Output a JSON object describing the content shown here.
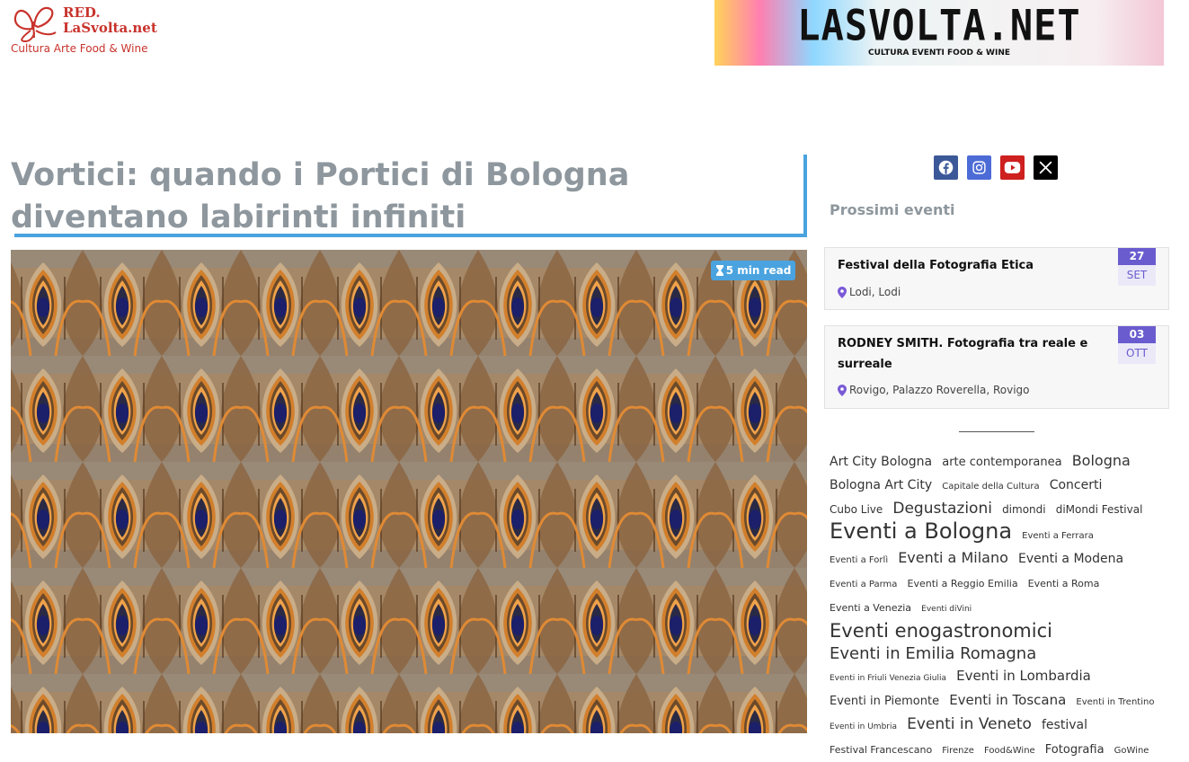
{
  "header": {
    "logo": {
      "name_line1": "RED.",
      "name_line2": "LaSvolta.net",
      "tagline": "Cultura Arte Food & Wine"
    },
    "banner": {
      "title": "LASVOLTA.NET",
      "subtitle": "CULTURA EVENTI FOOD & WINE"
    }
  },
  "article": {
    "title": "Vortici: quando i Portici di Bologna diventano labirinti infiniti",
    "read_time": "5 min read"
  },
  "social": [
    {
      "name": "facebook",
      "icon": "facebook-icon",
      "color": "#3b5998"
    },
    {
      "name": "instagram",
      "icon": "instagram-icon",
      "color": "#4c6bd6"
    },
    {
      "name": "youtube",
      "icon": "youtube-icon",
      "color": "#cd201f"
    },
    {
      "name": "x",
      "icon": "x-icon",
      "color": "#000000"
    }
  ],
  "sidebar": {
    "heading": "Prossimi eventi",
    "events": [
      {
        "title": "Festival della Fotografia Etica",
        "location": "Lodi, Lodi",
        "day": "27",
        "month": "SET"
      },
      {
        "title": "RODNEY SMITH. Fotografia tra reale e surreale",
        "location": "Rovigo, Palazzo Roverella, Rovigo",
        "day": "03",
        "month": "OTT"
      }
    ],
    "tags": [
      {
        "label": "Art City Bologna",
        "size": 14
      },
      {
        "label": "arte contemporanea",
        "size": 13
      },
      {
        "label": "Bologna",
        "size": 16
      },
      {
        "label": "Bologna Art City",
        "size": 14
      },
      {
        "label": "Capitale della Cultura",
        "size": 10
      },
      {
        "label": "Concerti",
        "size": 14
      },
      {
        "label": "Cubo Live",
        "size": 12
      },
      {
        "label": "Degustazioni",
        "size": 17
      },
      {
        "label": "dimondi",
        "size": 12
      },
      {
        "label": "diMondi Festival",
        "size": 12
      },
      {
        "label": "Eventi a Bologna",
        "size": 24
      },
      {
        "label": "Eventi a Ferrara",
        "size": 10
      },
      {
        "label": "Eventi a Forlì",
        "size": 10
      },
      {
        "label": "Eventi a Milano",
        "size": 16
      },
      {
        "label": "Eventi a Modena",
        "size": 14
      },
      {
        "label": "Eventi a Parma",
        "size": 10
      },
      {
        "label": "Eventi a Reggio Emilia",
        "size": 11
      },
      {
        "label": "Eventi a Roma",
        "size": 11
      },
      {
        "label": "Eventi a Venezia",
        "size": 11
      },
      {
        "label": "Eventi diVini",
        "size": 9
      },
      {
        "label": "Eventi enogastronomici",
        "size": 21
      },
      {
        "label": "Eventi in Emilia Romagna",
        "size": 18
      },
      {
        "label": "Eventi in Friuli Venezia Giulia",
        "size": 9
      },
      {
        "label": "Eventi in Lombardia",
        "size": 15
      },
      {
        "label": "Eventi in Piemonte",
        "size": 13
      },
      {
        "label": "Eventi in Toscana",
        "size": 15
      },
      {
        "label": "Eventi in Trentino",
        "size": 10
      },
      {
        "label": "Eventi in Umbria",
        "size": 9
      },
      {
        "label": "Eventi in Veneto",
        "size": 17
      },
      {
        "label": "festival",
        "size": 14
      },
      {
        "label": "Festival Francescano",
        "size": 11
      },
      {
        "label": "Firenze",
        "size": 10
      },
      {
        "label": "Food&Wine",
        "size": 10
      },
      {
        "label": "Fotografia",
        "size": 13
      },
      {
        "label": "GoWine",
        "size": 10
      }
    ]
  },
  "colors": {
    "accent": "#4aa3df",
    "brand": "#c8332c",
    "date_badge": "#6a5ccf"
  }
}
